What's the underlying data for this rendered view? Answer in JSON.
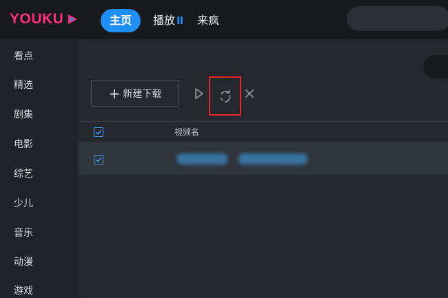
{
  "app": {
    "logo_text": "YOUKU"
  },
  "nav": {
    "home": "主页",
    "play": "播放",
    "play_mark": "II",
    "laifeng": "来疯"
  },
  "sidebar": {
    "items": [
      "看点",
      "精选",
      "剧集",
      "电影",
      "综艺",
      "少儿",
      "音乐",
      "动漫",
      "游戏"
    ]
  },
  "toolbar": {
    "new_download_label": "新建下载",
    "new_download_icon": "plus-icon",
    "play_icon": "play-icon",
    "retry_icon": "refresh-icon",
    "delete_icon": "close-icon",
    "highlight_color": "#e5262b"
  },
  "table": {
    "columns": [
      "视频名"
    ],
    "header_checked": true,
    "rows": [
      {
        "checked": true,
        "name_blurred": true
      }
    ]
  },
  "colors": {
    "accent": "#1f8ff5",
    "brand": "#ff2e7a",
    "topbar": "#17191d",
    "background": "#202328"
  }
}
